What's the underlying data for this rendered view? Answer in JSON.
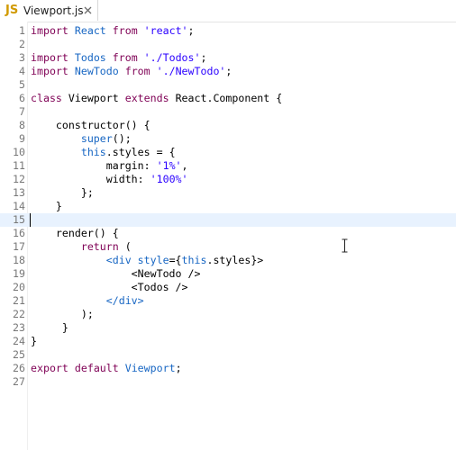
{
  "tab": {
    "badge": "JS",
    "filename": "Viewport.js"
  },
  "code_lines": [
    {
      "n": "1",
      "segs": [
        [
          "import ",
          "kw"
        ],
        [
          "React ",
          "blue"
        ],
        [
          "from ",
          "kw"
        ],
        [
          "'react'",
          "str"
        ],
        [
          ";",
          ""
        ]
      ]
    },
    {
      "n": "2",
      "segs": []
    },
    {
      "n": "3",
      "segs": [
        [
          "import ",
          "kw"
        ],
        [
          "Todos ",
          "blue"
        ],
        [
          "from ",
          "kw"
        ],
        [
          "'./Todos'",
          "str"
        ],
        [
          ";",
          ""
        ]
      ]
    },
    {
      "n": "4",
      "segs": [
        [
          "import ",
          "kw"
        ],
        [
          "NewTodo ",
          "blue"
        ],
        [
          "from ",
          "kw"
        ],
        [
          "'./NewTodo'",
          "str"
        ],
        [
          ";",
          ""
        ]
      ]
    },
    {
      "n": "5",
      "segs": []
    },
    {
      "n": "6",
      "segs": [
        [
          "class ",
          "kw"
        ],
        [
          "Viewport ",
          ""
        ],
        [
          "extends ",
          "kw"
        ],
        [
          "React.Component {",
          ""
        ]
      ]
    },
    {
      "n": "7",
      "segs": []
    },
    {
      "n": "8",
      "segs": [
        [
          "    constructor() {",
          ""
        ]
      ]
    },
    {
      "n": "9",
      "segs": [
        [
          "        ",
          ""
        ],
        [
          "super",
          "blue"
        ],
        [
          "();",
          ""
        ]
      ]
    },
    {
      "n": "10",
      "segs": [
        [
          "        ",
          ""
        ],
        [
          "this",
          "blue"
        ],
        [
          ".styles = {",
          ""
        ]
      ]
    },
    {
      "n": "11",
      "segs": [
        [
          "            margin: ",
          ""
        ],
        [
          "'1%'",
          "str"
        ],
        [
          ",",
          ""
        ]
      ]
    },
    {
      "n": "12",
      "segs": [
        [
          "            width: ",
          ""
        ],
        [
          "'100%'",
          "str"
        ]
      ]
    },
    {
      "n": "13",
      "segs": [
        [
          "        };",
          ""
        ]
      ]
    },
    {
      "n": "14",
      "segs": [
        [
          "    }",
          ""
        ]
      ]
    },
    {
      "n": "15",
      "segs": [],
      "current": true
    },
    {
      "n": "16",
      "segs": [
        [
          "    render() {",
          ""
        ]
      ]
    },
    {
      "n": "17",
      "segs": [
        [
          "        ",
          ""
        ],
        [
          "return",
          "kw"
        ],
        [
          " (",
          ""
        ]
      ]
    },
    {
      "n": "18",
      "segs": [
        [
          "            ",
          ""
        ],
        [
          "<div ",
          "blue"
        ],
        [
          "style",
          "blue"
        ],
        [
          "={",
          ""
        ],
        [
          "this",
          "blue"
        ],
        [
          ".styles}>",
          ""
        ]
      ]
    },
    {
      "n": "19",
      "segs": [
        [
          "                <NewTodo />",
          ""
        ]
      ]
    },
    {
      "n": "20",
      "segs": [
        [
          "                <Todos />",
          ""
        ]
      ]
    },
    {
      "n": "21",
      "segs": [
        [
          "            ",
          ""
        ],
        [
          "</div>",
          "blue"
        ]
      ]
    },
    {
      "n": "22",
      "segs": [
        [
          "        );",
          ""
        ]
      ]
    },
    {
      "n": "23",
      "segs": [
        [
          "     }",
          ""
        ]
      ]
    },
    {
      "n": "24",
      "segs": [
        [
          "}",
          ""
        ]
      ]
    },
    {
      "n": "25",
      "segs": []
    },
    {
      "n": "26",
      "segs": [
        [
          "export ",
          "kw"
        ],
        [
          "default ",
          "kw"
        ],
        [
          "Viewport",
          "blue"
        ],
        [
          ";",
          ""
        ]
      ]
    },
    {
      "n": "27",
      "segs": []
    }
  ]
}
